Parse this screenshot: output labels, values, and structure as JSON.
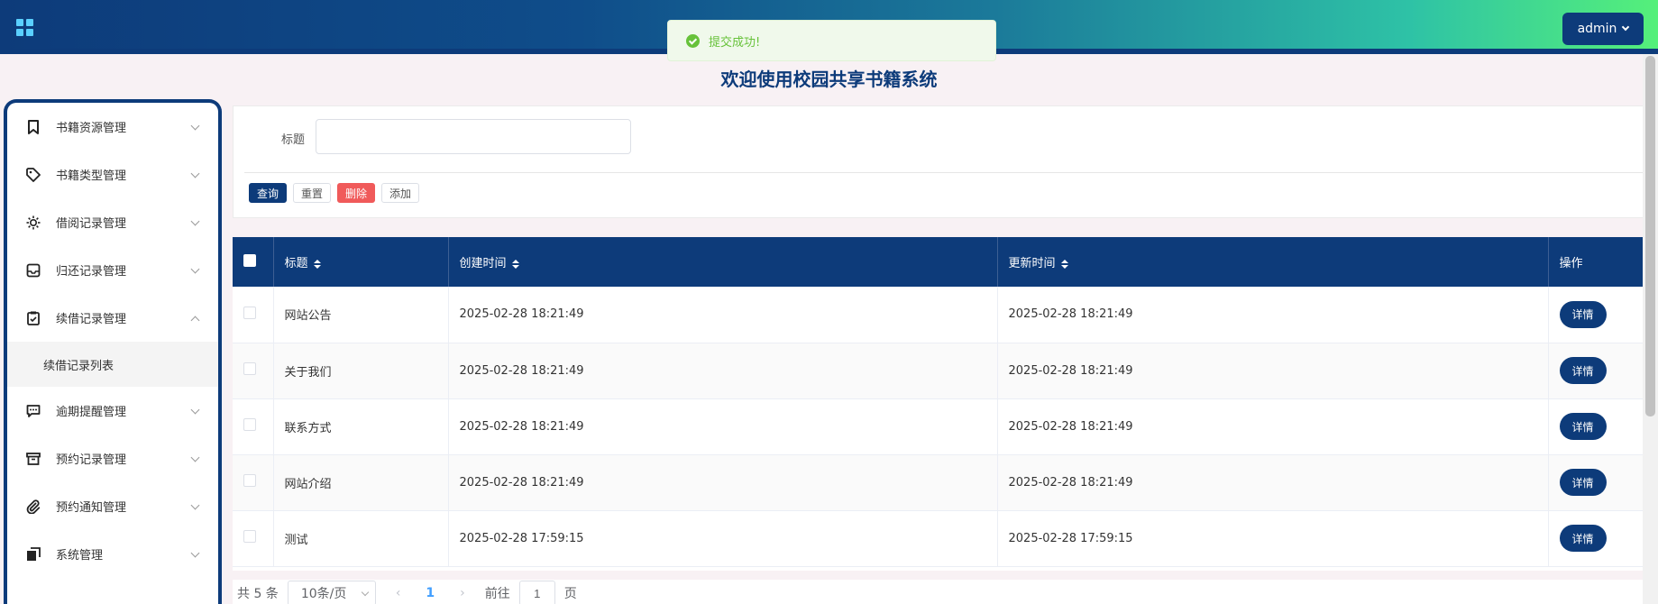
{
  "header": {
    "user_label": "admin"
  },
  "toast": {
    "message": "提交成功!"
  },
  "page_title": "欢迎使用校园共享书籍系统",
  "sidebar": {
    "items": [
      {
        "label": "书籍资源管理",
        "icon": "bookmark-icon"
      },
      {
        "label": "书籍类型管理",
        "icon": "tag-icon"
      },
      {
        "label": "借阅记录管理",
        "icon": "sun-icon"
      },
      {
        "label": "归还记录管理",
        "icon": "inbox-icon"
      },
      {
        "label": "续借记录管理",
        "icon": "clipboard-check-icon",
        "expanded": true
      },
      {
        "label": "逾期提醒管理",
        "icon": "chat-icon"
      },
      {
        "label": "预约记录管理",
        "icon": "archive-icon"
      },
      {
        "label": "预约通知管理",
        "icon": "paperclip-icon"
      },
      {
        "label": "系统管理",
        "icon": "copy-icon"
      }
    ],
    "sub_item": "续借记录列表"
  },
  "search": {
    "title_label": "标题",
    "title_value": "",
    "buttons": {
      "query": "查询",
      "reset": "重置",
      "delete": "删除",
      "add": "添加"
    }
  },
  "table": {
    "columns": [
      "标题",
      "创建时间",
      "更新时间",
      "操作"
    ],
    "rows": [
      {
        "title": "网站公告",
        "created": "2025-02-28 18:21:49",
        "updated": "2025-02-28 18:21:49",
        "action": "详情"
      },
      {
        "title": "关于我们",
        "created": "2025-02-28 18:21:49",
        "updated": "2025-02-28 18:21:49",
        "action": "详情"
      },
      {
        "title": "联系方式",
        "created": "2025-02-28 18:21:49",
        "updated": "2025-02-28 18:21:49",
        "action": "详情"
      },
      {
        "title": "网站介绍",
        "created": "2025-02-28 18:21:49",
        "updated": "2025-02-28 18:21:49",
        "action": "详情"
      },
      {
        "title": "测试",
        "created": "2025-02-28 17:59:15",
        "updated": "2025-02-28 17:59:15",
        "action": "详情"
      }
    ]
  },
  "pagination": {
    "total": "共 5 条",
    "page_size": "10条/页",
    "prev": "‹",
    "current": "1",
    "next": "›",
    "goto_label": "前往",
    "goto_value": "1",
    "page_suffix": "页"
  },
  "colors": {
    "primary": "#0d3b7a",
    "danger": "#f05a5a",
    "success": "#67c23a"
  }
}
